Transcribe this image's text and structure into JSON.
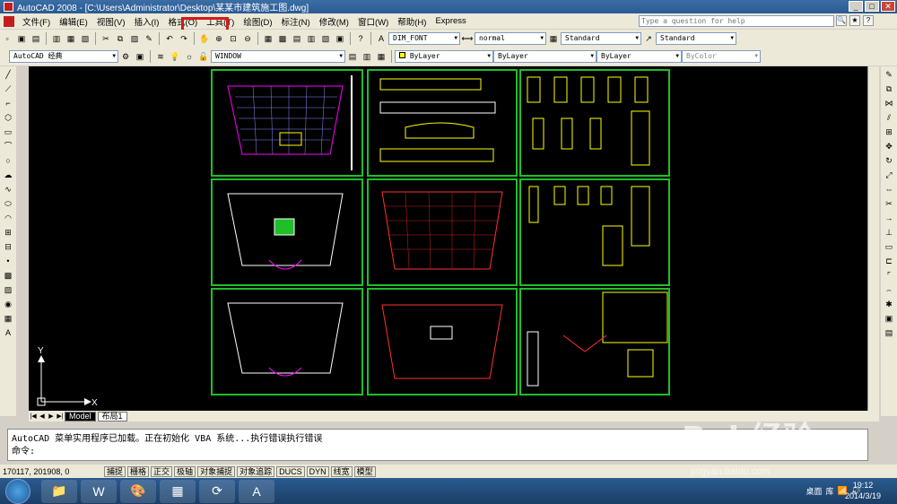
{
  "window": {
    "title": "AutoCAD 2008 - [C:\\Users\\Administrator\\Desktop\\某某市建筑施工图.dwg]"
  },
  "menu": {
    "items": [
      "文件(F)",
      "编辑(E)",
      "视图(V)",
      "插入(I)",
      "格式(O)",
      "工具(T)",
      "绘图(D)",
      "标注(N)",
      "修改(M)",
      "窗口(W)",
      "帮助(H)",
      "Express"
    ],
    "help_placeholder": "Type a question for help"
  },
  "styles": {
    "text_style": "DIM_FONT",
    "dim_style": "normal",
    "table_style": "Standard",
    "multileader_style": "Standard"
  },
  "layers": {
    "workspace": "AutoCAD 经典",
    "current_layer": "WINDOW",
    "color": "ByLayer",
    "linetype": "ByLayer",
    "lineweight": "ByLayer",
    "plotstyle": "ByColor"
  },
  "tabs": [
    "Model",
    "布局1"
  ],
  "command": {
    "line1": "AutoCAD 菜单实用程序已加载。正在初始化 VBA 系统...执行错误执行错误",
    "prompt": "命令:"
  },
  "status": {
    "coords": "170117, 201908, 0",
    "buttons": [
      "捕捉",
      "栅格",
      "正交",
      "极轴",
      "对象捕捉",
      "对象追踪",
      "DUCS",
      "DYN",
      "线宽",
      "模型"
    ]
  },
  "taskbar": {
    "desktop_label": "桌面",
    "lib_label": "库",
    "time": "19:12",
    "date": "2014/3/19"
  },
  "watermark": {
    "text": "Bai 经验",
    "sub": "jingyan.baidu.com"
  },
  "ucs": {
    "x_label": "X",
    "y_label": "Y"
  },
  "colors": {
    "canvas_bg": "#000000",
    "frame": "#1fbf2a",
    "highlight": "#d21b1b"
  }
}
